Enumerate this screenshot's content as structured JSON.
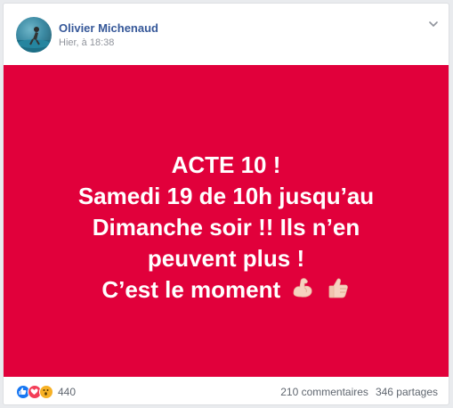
{
  "post": {
    "author": "Olivier Michenaud",
    "timestamp": "Hier, à 18:38",
    "media_background": "#e1003b",
    "media_lines": [
      "ACTE 10 !",
      "Samedi 19 de 10h jusqu’au",
      "Dimanche soir !! Ils n’en",
      "peuvent plus !",
      "C’est le moment"
    ],
    "emojis": [
      "flexed-biceps-icon",
      "thumbs-up-icon"
    ]
  },
  "footer": {
    "reactions": [
      "like-icon",
      "love-icon",
      "wow-icon"
    ],
    "reaction_count": "440",
    "comments": "210 commentaires",
    "shares": "346 partages"
  },
  "colors": {
    "author": "#365899",
    "like": "#1877f2",
    "love": "#f33e58",
    "wow": "#f7b125"
  }
}
